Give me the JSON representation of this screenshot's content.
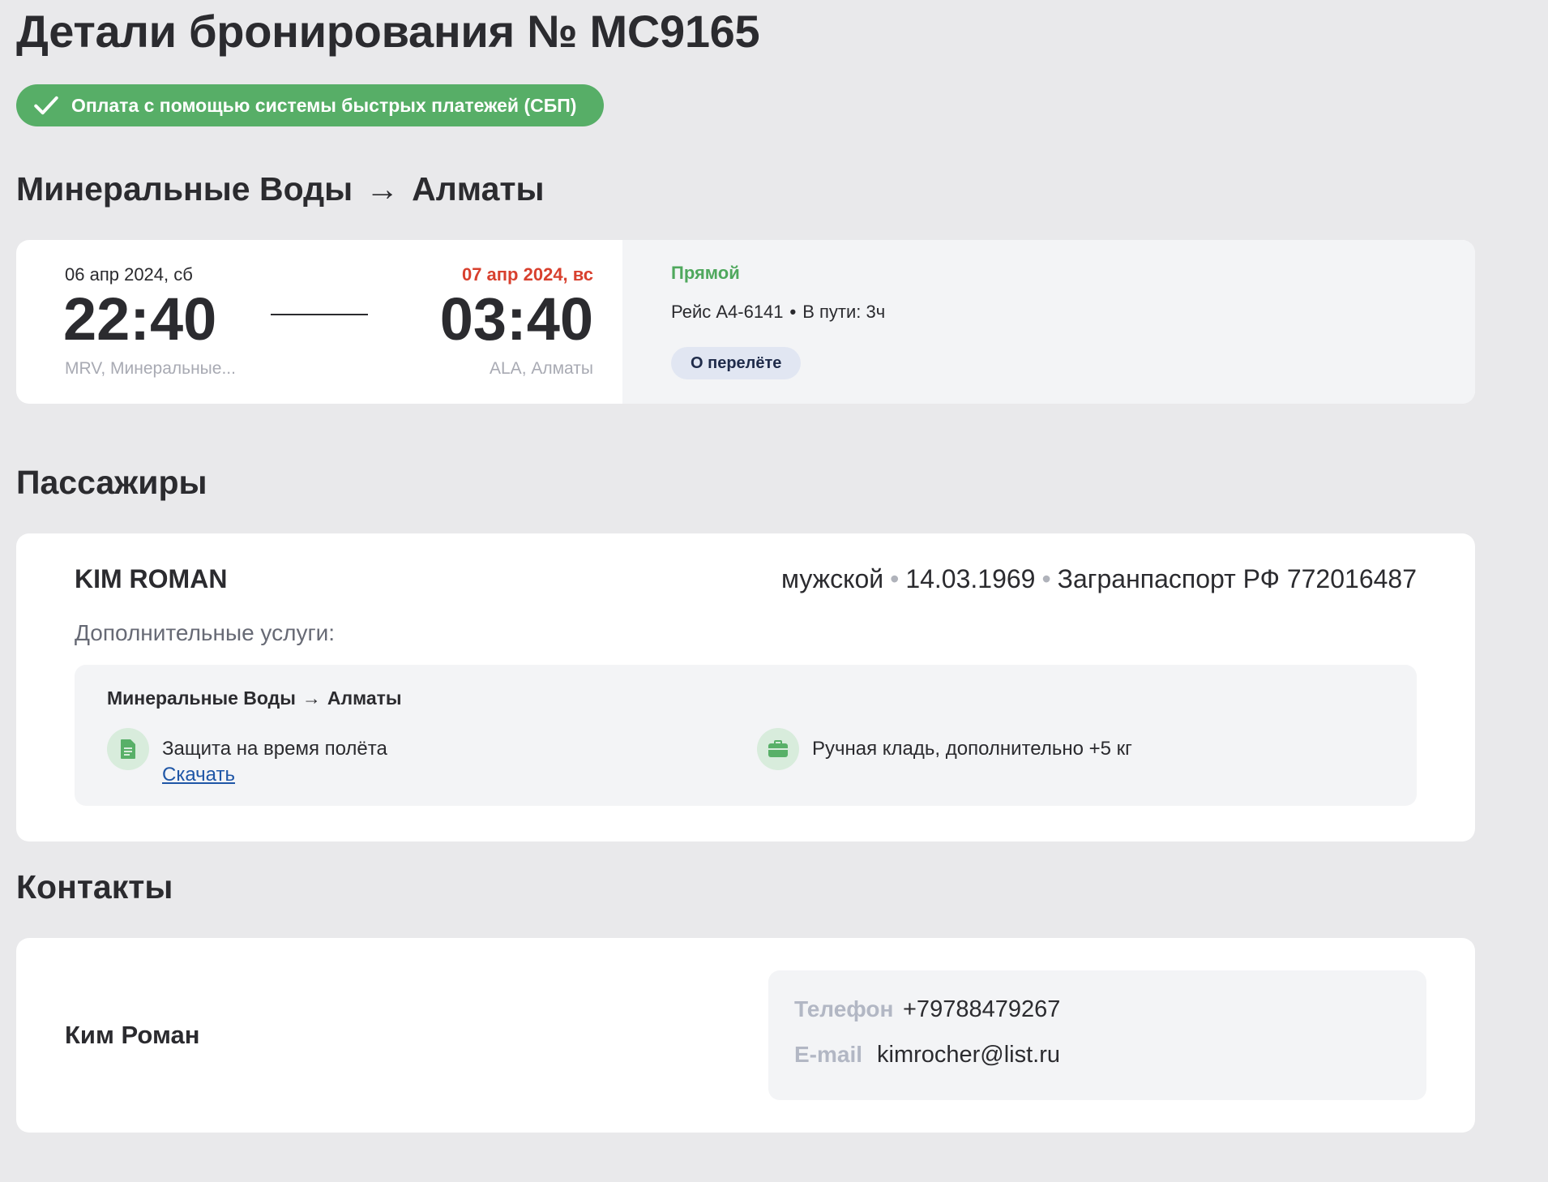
{
  "page": {
    "title": "Детали бронирования № MC9165",
    "payment_badge": "Оплата с помощью системы быстрых платежей (СБП)"
  },
  "route": {
    "from": "Минеральные Воды",
    "arrow": "→",
    "to": "Алматы"
  },
  "flight": {
    "departure_date": "06 апр 2024, сб",
    "departure_time": "22:40",
    "departure_airport": "MRV, Минеральные...",
    "arrival_date": "07 апр 2024, вс",
    "arrival_time": "03:40",
    "arrival_airport": "ALA, Алматы",
    "type": "Прямой",
    "number": "Рейс A4-6141",
    "dot": "•",
    "duration": "В пути: 3ч",
    "about_button": "О перелёте"
  },
  "passengers": {
    "section_title": "Пассажиры",
    "items": [
      {
        "name": "KIM ROMAN",
        "gender": "мужской",
        "birth_date": "14.03.1969",
        "document": "Загранпаспорт РФ 772016487",
        "separator": "•",
        "services_label": "Дополнительные услуги:",
        "services_route_from": "Минеральные Воды",
        "services_route_arrow": "→",
        "services_route_to": "Алматы",
        "services": [
          {
            "label": "Защита на время полёта",
            "link": "Скачать",
            "icon": "document-icon"
          },
          {
            "label": "Ручная кладь, дополнительно +5 кг",
            "icon": "briefcase-icon"
          }
        ]
      }
    ]
  },
  "contacts": {
    "section_title": "Контакты",
    "name": "Ким Роман",
    "phone_label": "Телефон",
    "phone": "+79788479267",
    "email_label": "E-mail",
    "email": "kimrocher@list.ru"
  },
  "colors": {
    "background": "#e9e9eb",
    "success_green": "#57ae67",
    "arrival_red": "#d8402e",
    "link_blue": "#1f56a6"
  }
}
